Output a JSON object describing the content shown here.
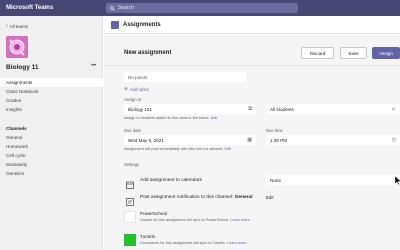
{
  "app": {
    "title": "Microsoft Teams"
  },
  "search": {
    "placeholder": "Search"
  },
  "left": {
    "back_label": "All teams",
    "team_name": "Biology 11",
    "team_nav": [
      "Assignments",
      "Class Notebook",
      "Grades",
      "Insights"
    ],
    "channels_heading": "Channels",
    "channels": [
      "General",
      "Homework",
      "Cell cycle",
      "Modularity",
      "Genetics"
    ]
  },
  "header": {
    "title": "Assignments"
  },
  "form": {
    "title": "New assignment",
    "discard": "Discard",
    "save": "Save",
    "assign": "Assign",
    "points_value": "No points",
    "add_rubric": "Add rubric",
    "assign_to_label": "Assign to",
    "class_value": "Biology 101",
    "students_value": "All students",
    "assign_hint": "Assign to students added to this class in the future.",
    "assign_hint_link": "Edit",
    "due_date_label": "Due date",
    "due_date_value": "Wed May 5, 2021",
    "due_time_label": "Due time",
    "due_time_value": "1:30 PM",
    "post_hint": "Assignment will post immediately with late turn-ins allowed.",
    "post_hint_link": "Edit",
    "settings_heading": "Settings",
    "calendar_label": "Add assignment to calendars",
    "calendar_value": "None",
    "notify_label": "Post assignment notification to this channel:",
    "notify_channel": "General",
    "notify_edit": "Edit",
    "powerschool_title": "PowerSchool",
    "powerschool_desc": "Grades for this assignment will sync to PowerSchool.",
    "powerschool_link": "Learn more",
    "turnitin_title": "Turnitin",
    "turnitin_desc": "Documents for this assignment will sync to Turnitin.",
    "turnitin_link": "Learn more"
  },
  "colors": {
    "brand": "#464775",
    "accent": "#6264a7",
    "turnitin": "#22c32a"
  }
}
